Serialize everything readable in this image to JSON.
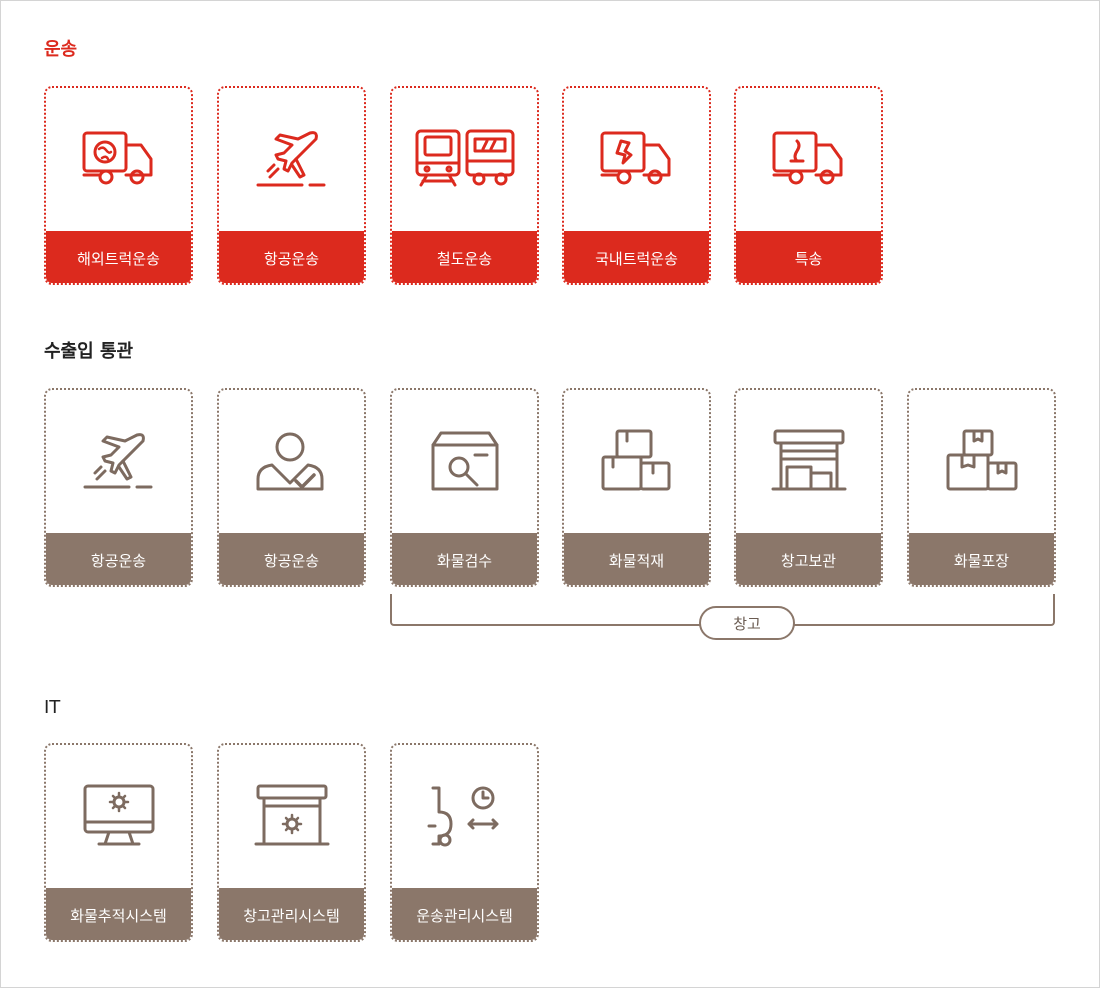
{
  "sections": {
    "transport": {
      "title": "운송",
      "cards": [
        {
          "label": "해외트럭운송",
          "icon": "globe-truck-icon"
        },
        {
          "label": "항공운송",
          "icon": "airplane-icon"
        },
        {
          "label": "철도운송",
          "icon": "train-icon"
        },
        {
          "label": "국내트럭운송",
          "icon": "map-truck-icon"
        },
        {
          "label": "특송",
          "icon": "express-truck-icon"
        }
      ]
    },
    "customs": {
      "title": "수출입 통관",
      "cards": [
        {
          "label": "항공운송",
          "icon": "airplane-icon"
        },
        {
          "label": "항공운송",
          "icon": "person-check-icon"
        },
        {
          "label": "화물검수",
          "icon": "box-search-icon"
        },
        {
          "label": "화물적재",
          "icon": "stacked-boxes-icon"
        },
        {
          "label": "창고보관",
          "icon": "warehouse-icon"
        },
        {
          "label": "화물포장",
          "icon": "package-icon"
        }
      ],
      "group_label": "창고"
    },
    "it": {
      "title": "IT",
      "cards": [
        {
          "label": "화물추적시스템",
          "icon": "monitor-gear-icon"
        },
        {
          "label": "창고관리시스템",
          "icon": "warehouse-gear-icon"
        },
        {
          "label": "운송관리시스템",
          "icon": "route-clock-icon"
        }
      ]
    }
  },
  "colors": {
    "transport_accent": "#dc2a1e",
    "customs_accent": "#8b776a",
    "it_accent": "#8b776a"
  }
}
